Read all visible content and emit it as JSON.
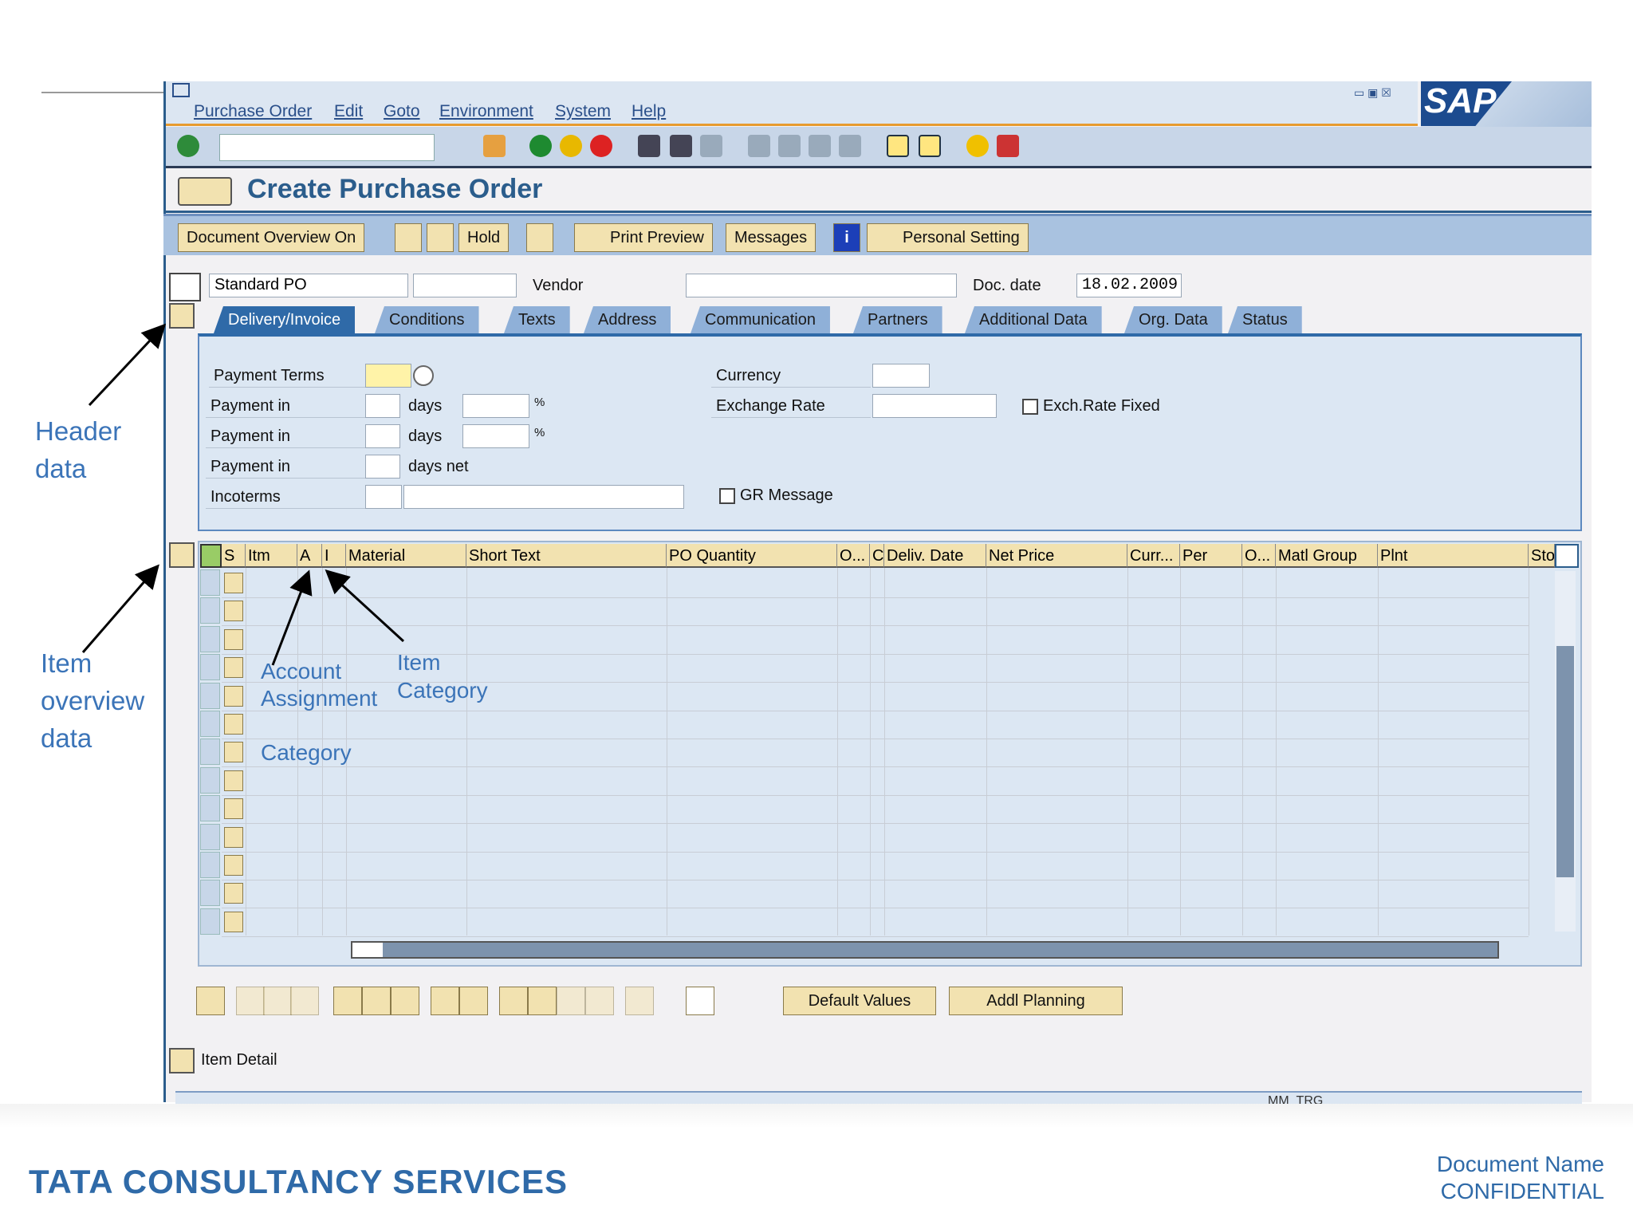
{
  "menu": [
    "Purchase Order",
    "Edit",
    "Goto",
    "Environment",
    "System",
    "Help"
  ],
  "title": "Create Purchase Order",
  "app_toolbar": {
    "doc_overview": "Document Overview On",
    "hold": "Hold",
    "print_preview": "Print Preview",
    "messages": "Messages",
    "personal_setting": "Personal Setting"
  },
  "header": {
    "doc_type": "Standard PO",
    "vendor_label": "Vendor",
    "vendor": "",
    "doc_date_label": "Doc. date",
    "doc_date": "18.02.2009"
  },
  "tabs": [
    "Delivery/Invoice",
    "Conditions",
    "Texts",
    "Address",
    "Communication",
    "Partners",
    "Additional Data",
    "Org. Data",
    "Status"
  ],
  "delivery_invoice": {
    "payment_terms": "Payment Terms",
    "payment_in": "Payment in",
    "days": "days",
    "days_net": "days net",
    "percent": "%",
    "incoterms": "Incoterms",
    "currency": "Currency",
    "exchange_rate": "Exchange Rate",
    "exch_rate_fixed": "Exch.Rate Fixed",
    "gr_message": "GR Message"
  },
  "item_columns": [
    "S",
    "Itm",
    "A",
    "I",
    "Material",
    "Short Text",
    "PO Quantity",
    "O...",
    "C",
    "Deliv. Date",
    "Net Price",
    "Curr...",
    "Per",
    "O...",
    "Matl Group",
    "Plnt",
    "Sto"
  ],
  "bottom_buttons": {
    "default_values": "Default Values",
    "addl_planning": "Addl Planning"
  },
  "item_detail": "Item Detail",
  "status_bar": "MM_TRG",
  "annotations": {
    "header": "Header\ndata",
    "item_overview": "Item\noverview\ndata",
    "account_assignment": "Account\nAssignment\n\nCategory",
    "item_category": "Item\nCategory"
  },
  "footer": {
    "company": "TATA CONSULTANCY SERVICES",
    "doc_name": "Document Name",
    "confidential": "CONFIDENTIAL"
  },
  "brand": {
    "logo": "SAP"
  }
}
